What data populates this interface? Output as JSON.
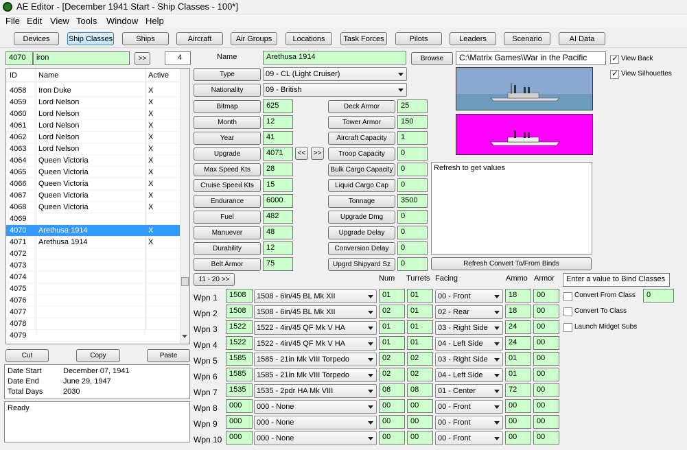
{
  "window": {
    "title": "AE Editor - [December 1941 Start - Ship Classes - 100*]"
  },
  "menu": [
    "File",
    "Edit",
    "View",
    "Tools",
    "Window",
    "Help"
  ],
  "tabs": [
    "Devices",
    "Ship Classes",
    "Ships",
    "Aircraft",
    "Air Groups",
    "Locations",
    "Task Forces",
    "Pilots",
    "Leaders",
    "Scenario",
    "AI Data"
  ],
  "search": {
    "id": "4070",
    "name": "iron",
    "nav": ">>",
    "count": "4"
  },
  "list": {
    "headers": [
      "ID",
      "Name",
      "Active"
    ],
    "rows": [
      [
        "4058",
        "Iron Duke",
        "X"
      ],
      [
        "4059",
        "Lord Nelson",
        "X"
      ],
      [
        "4060",
        "Lord Nelson",
        "X"
      ],
      [
        "4061",
        "Lord Nelson",
        "X"
      ],
      [
        "4062",
        "Lord Nelson",
        "X"
      ],
      [
        "4063",
        "Lord Nelson",
        "X"
      ],
      [
        "4064",
        "Queen Victoria",
        "X"
      ],
      [
        "4065",
        "Queen Victoria",
        "X"
      ],
      [
        "4066",
        "Queen Victoria",
        "X"
      ],
      [
        "4067",
        "Queen Victoria",
        "X"
      ],
      [
        "4068",
        "Queen Victoria",
        "X"
      ],
      [
        "4069",
        "",
        ""
      ],
      [
        "4070",
        "Arethusa 1914",
        "X"
      ],
      [
        "4071",
        "Arethusa 1914",
        "X"
      ],
      [
        "4072",
        "",
        ""
      ],
      [
        "4073",
        "",
        ""
      ],
      [
        "4074",
        "",
        ""
      ],
      [
        "4075",
        "",
        ""
      ],
      [
        "4076",
        "",
        ""
      ],
      [
        "4077",
        "",
        ""
      ],
      [
        "4078",
        "",
        ""
      ],
      [
        "4079",
        "",
        ""
      ]
    ],
    "selected_id": "4070"
  },
  "edit_buttons": [
    "Cut",
    "Copy",
    "Paste"
  ],
  "dates": {
    "start_label": "Date Start",
    "start": "December 07, 1941",
    "end_label": "Date End",
    "end": "June 29, 1947",
    "total_label": "Total Days",
    "total": "2030"
  },
  "status": "Ready",
  "form": {
    "name_label": "Name",
    "name": "Arethusa 1914",
    "browse": "Browse",
    "path": "C:\\Matrix Games\\War in the Pacific",
    "type_label": "Type",
    "type": "09 - CL (Light Cruiser)",
    "nationality_label": "Nationality",
    "nationality": "09 - British",
    "left_fields": [
      [
        "Bitmap",
        "625"
      ],
      [
        "Month",
        "12"
      ],
      [
        "Year",
        "41"
      ],
      [
        "Upgrade",
        "4071"
      ],
      [
        "Max Speed Kts",
        "28"
      ],
      [
        "Cruise Speed Kts",
        "15"
      ],
      [
        "Endurance",
        "6000"
      ],
      [
        "Fuel",
        "482"
      ],
      [
        "Manuever",
        "48"
      ],
      [
        "Durability",
        "12"
      ],
      [
        "Belt Armor",
        "75"
      ]
    ],
    "upgrade_prev": "<<",
    "upgrade_next": ">>",
    "right_fields": [
      [
        "Deck Armor",
        "25"
      ],
      [
        "Tower Armor",
        "150"
      ],
      [
        "Aircraft Capacity",
        "1"
      ],
      [
        "Troop Capacity",
        "0"
      ],
      [
        "Bulk Cargo Capacity",
        "0"
      ],
      [
        "Liquid Cargo Cap",
        "0"
      ],
      [
        "Tonnage",
        "3500"
      ],
      [
        "Upgrade Dmg",
        "0"
      ],
      [
        "Upgrade Delay",
        "0"
      ],
      [
        "Conversion Delay",
        "0"
      ],
      [
        "Upgrd Shipyard Sz",
        "0"
      ]
    ]
  },
  "view": {
    "back_label": "View Back",
    "back": true,
    "silhouettes_label": "View Silhouettes",
    "silhouettes": true
  },
  "colors": {
    "sea_top": "#8aa8d2",
    "sea": "#6f9bbd",
    "silhouette_bg": "#ff00ff"
  },
  "info_text": "Refresh to get values",
  "refresh_btn": "Refresh Convert To/From Binds",
  "weapons": {
    "page_btn": "11 - 20  >>",
    "headers": {
      "num": "Num",
      "turrets": "Turrets",
      "facing": "Facing",
      "ammo": "Ammo",
      "armor": "Armor"
    },
    "rows": [
      [
        "Wpn 1",
        "1508",
        "1508 - 6in/45 BL Mk XII",
        "01",
        "01",
        "00 - Front",
        "18",
        "00"
      ],
      [
        "Wpn 2",
        "1508",
        "1508 - 6in/45 BL Mk XII",
        "02",
        "01",
        "02 - Rear",
        "18",
        "00"
      ],
      [
        "Wpn 3",
        "1522",
        "1522 - 4in/45 QF Mk V HA",
        "01",
        "01",
        "03 - Right Side",
        "24",
        "00"
      ],
      [
        "Wpn 4",
        "1522",
        "1522 - 4in/45 QF Mk V HA",
        "01",
        "01",
        "04 - Left Side",
        "24",
        "00"
      ],
      [
        "Wpn 5",
        "1585",
        "1585 - 21in Mk VIII Torpedo",
        "02",
        "02",
        "03 - Right Side",
        "01",
        "00"
      ],
      [
        "Wpn 6",
        "1585",
        "1585 - 21in Mk VIII Torpedo",
        "02",
        "02",
        "04 - Left Side",
        "01",
        "00"
      ],
      [
        "Wpn 7",
        "1535",
        "1535 - 2pdr HA Mk VIII",
        "08",
        "08",
        "01 - Center",
        "72",
        "00"
      ],
      [
        "Wpn 8",
        "000",
        "000 - None",
        "00",
        "00",
        "00 - Front",
        "00",
        "00"
      ],
      [
        "Wpn 9",
        "000",
        "000 - None",
        "00",
        "00",
        "00 - Front",
        "00",
        "00"
      ],
      [
        "Wpn 10",
        "000",
        "000 - None",
        "00",
        "00",
        "00 - Front",
        "00",
        "00"
      ]
    ]
  },
  "binds": {
    "hint": "Enter a value to Bind Classes",
    "convert_from_label": "Convert From Class",
    "convert_from": false,
    "convert_from_value": "0",
    "convert_to_label": "Convert To Class",
    "convert_to": false,
    "midget_label": "Launch Midget Subs",
    "midget": false
  }
}
